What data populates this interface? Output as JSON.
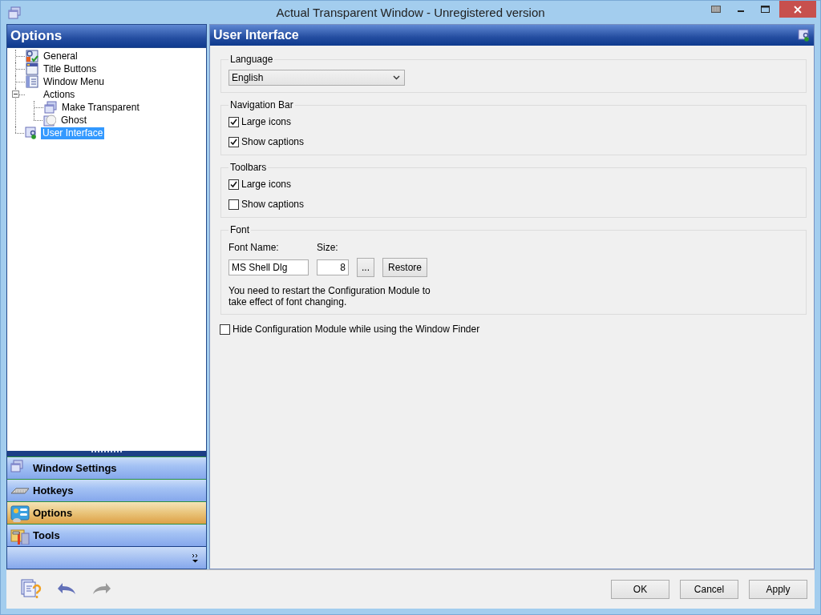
{
  "window": {
    "title": "Actual Transparent Window - Unregistered version"
  },
  "sidebar": {
    "title": "Options",
    "tree": [
      {
        "label": "General",
        "selected": false
      },
      {
        "label": "Title Buttons",
        "selected": false
      },
      {
        "label": "Window Menu",
        "selected": false
      },
      {
        "label": "Actions",
        "selected": false,
        "expanded": true,
        "children": [
          {
            "label": "Make Transparent",
            "selected": false
          },
          {
            "label": "Ghost",
            "selected": false
          }
        ]
      },
      {
        "label": "User Interface",
        "selected": true
      }
    ],
    "nav": [
      {
        "label": "Window Settings",
        "selected": false
      },
      {
        "label": "Hotkeys",
        "selected": false
      },
      {
        "label": "Options",
        "selected": true
      },
      {
        "label": "Tools",
        "selected": false
      }
    ]
  },
  "panel": {
    "title": "User Interface",
    "groups": [
      {
        "kind": "select",
        "title": "Language",
        "value": "English"
      },
      {
        "kind": "checks",
        "title": "Navigation Bar",
        "items": [
          {
            "label": "Large icons",
            "checked": true
          },
          {
            "label": "Show captions",
            "checked": true
          }
        ]
      },
      {
        "kind": "checks",
        "title": "Toolbars",
        "items": [
          {
            "label": "Large icons",
            "checked": true
          },
          {
            "label": "Show captions",
            "checked": false
          }
        ]
      },
      {
        "kind": "font",
        "title": "Font",
        "name_label": "Font Name:",
        "size_label": "Size:",
        "name_value": "MS Shell Dlg",
        "size_value": "8",
        "browse": "...",
        "restore": "Restore",
        "note": "You need to restart the Configuration Module to take effect of font changing."
      }
    ],
    "hide_finder": {
      "label": "Hide Configuration Module while using the Window Finder",
      "checked": false
    }
  },
  "toolbar": [
    {
      "kind": "help"
    },
    {
      "kind": "undo",
      "disabled": false
    },
    {
      "kind": "redo",
      "disabled": true
    }
  ],
  "buttons": [
    "OK",
    "Cancel",
    "Apply"
  ]
}
